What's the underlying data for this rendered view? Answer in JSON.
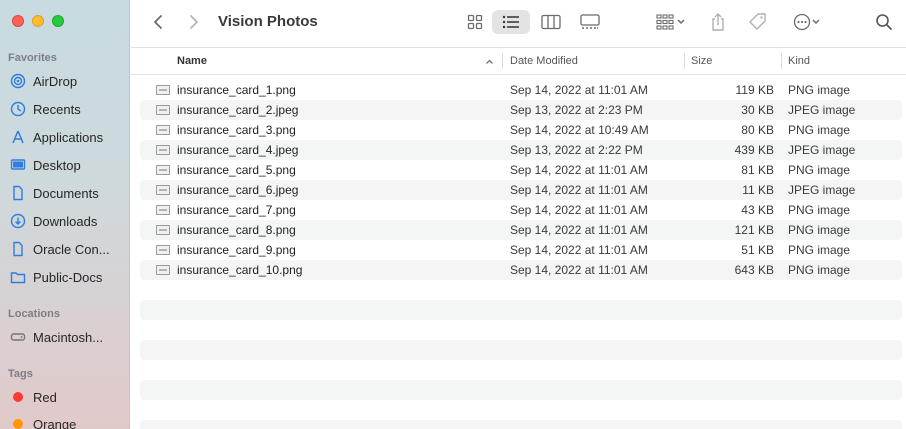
{
  "window": {
    "title": "Vision Photos"
  },
  "sidebar": {
    "favorites_label": "Favorites",
    "favorites": [
      {
        "label": "AirDrop",
        "icon": "airdrop-icon"
      },
      {
        "label": "Recents",
        "icon": "clock-icon"
      },
      {
        "label": "Applications",
        "icon": "applications-icon"
      },
      {
        "label": "Desktop",
        "icon": "desktop-icon"
      },
      {
        "label": "Documents",
        "icon": "document-icon"
      },
      {
        "label": "Downloads",
        "icon": "download-icon"
      },
      {
        "label": "Oracle Con...",
        "icon": "document-icon"
      },
      {
        "label": "Public-Docs",
        "icon": "folder-icon"
      }
    ],
    "locations_label": "Locations",
    "locations": [
      {
        "label": "Macintosh...",
        "icon": "disk-icon"
      }
    ],
    "tags_label": "Tags",
    "tags": [
      {
        "label": "Red",
        "color": "#ff3b30"
      },
      {
        "label": "Orange",
        "color": "#ff9500"
      }
    ]
  },
  "columns": {
    "name": "Name",
    "date": "Date Modified",
    "size": "Size",
    "kind": "Kind"
  },
  "files": [
    {
      "name": "insurance_card_1.png",
      "date": "Sep 14, 2022 at 11:01 AM",
      "size": "119 KB",
      "kind": "PNG image"
    },
    {
      "name": "insurance_card_2.jpeg",
      "date": "Sep 13, 2022 at 2:23 PM",
      "size": "30 KB",
      "kind": "JPEG image"
    },
    {
      "name": "insurance_card_3.png",
      "date": "Sep 14, 2022 at 10:49 AM",
      "size": "80 KB",
      "kind": "PNG image"
    },
    {
      "name": "insurance_card_4.jpeg",
      "date": "Sep 13, 2022 at 2:22 PM",
      "size": "439 KB",
      "kind": "JPEG image"
    },
    {
      "name": "insurance_card_5.png",
      "date": "Sep 14, 2022 at 11:01 AM",
      "size": "81 KB",
      "kind": "PNG image"
    },
    {
      "name": "insurance_card_6.jpeg",
      "date": "Sep 14, 2022 at 11:01 AM",
      "size": "11 KB",
      "kind": "JPEG image"
    },
    {
      "name": "insurance_card_7.png",
      "date": "Sep 14, 2022 at 11:01 AM",
      "size": "43 KB",
      "kind": "PNG image"
    },
    {
      "name": "insurance_card_8.png",
      "date": "Sep 14, 2022 at 11:01 AM",
      "size": "121 KB",
      "kind": "PNG image"
    },
    {
      "name": "insurance_card_9.png",
      "date": "Sep 14, 2022 at 11:01 AM",
      "size": "51 KB",
      "kind": "PNG image"
    },
    {
      "name": "insurance_card_10.png",
      "date": "Sep 14, 2022 at 11:01 AM",
      "size": "643 KB",
      "kind": "PNG image"
    }
  ]
}
